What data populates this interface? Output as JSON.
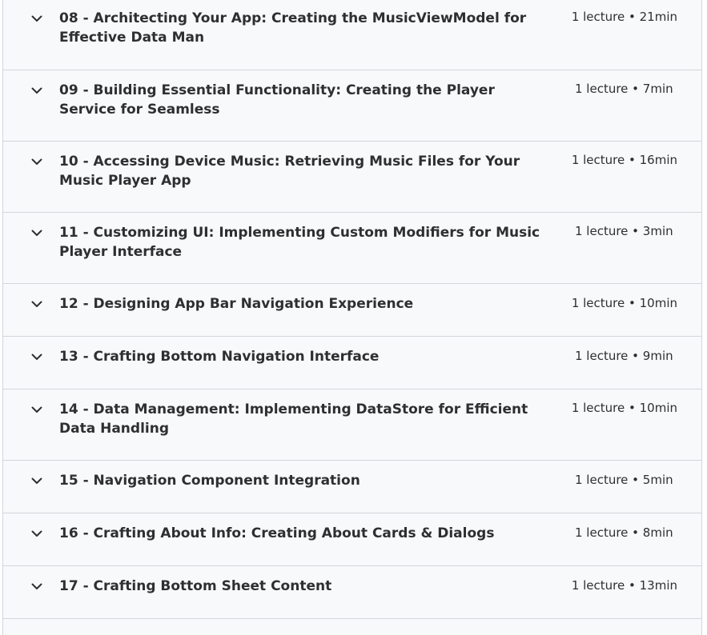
{
  "sections": [
    {
      "title": "08 - Architecting Your App: Creating the MusicViewModel for Effective Data Man",
      "meta": "1 lecture • 21min"
    },
    {
      "title": "09 - Building Essential Functionality: Creating the Player Service for Seamless",
      "meta": "1 lecture • 7min"
    },
    {
      "title": "10 - Accessing Device Music: Retrieving Music Files for Your Music Player App",
      "meta": "1 lecture • 16min"
    },
    {
      "title": "11 - Customizing UI: Implementing Custom Modifiers for Music Player Interface",
      "meta": "1 lecture • 3min"
    },
    {
      "title": "12 - Designing App Bar Navigation Experience",
      "meta": "1 lecture • 10min"
    },
    {
      "title": "13 - Crafting Bottom Navigation Interface",
      "meta": "1 lecture • 9min"
    },
    {
      "title": "14 - Data Management: Implementing DataStore for Efficient Data Handling",
      "meta": "1 lecture • 10min"
    },
    {
      "title": "15 - Navigation Component Integration",
      "meta": "1 lecture • 5min"
    },
    {
      "title": "16 - Crafting About Info: Creating About Cards & Dialogs",
      "meta": "1 lecture • 8min"
    },
    {
      "title": "17 - Crafting Bottom Sheet Content",
      "meta": "1 lecture • 13min"
    }
  ],
  "icons": {
    "expand": "chevron-down-icon"
  },
  "colors": {
    "section_bg": "#f7f9fa",
    "border": "#d1d7dc",
    "text": "#2d2f31"
  }
}
